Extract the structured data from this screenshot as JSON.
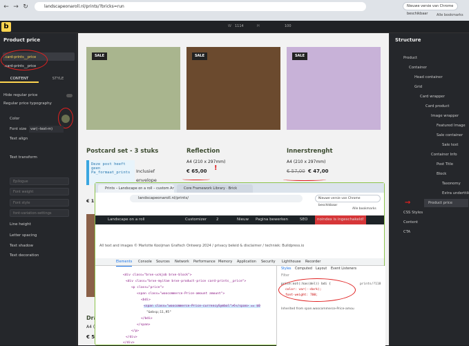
{
  "browser": {
    "url": "landscapeonaroll.nl/prints/?bricks=run",
    "new_version": "Nieuwe versie van Chrome beschikbaar",
    "bookmarks": "Alle bookmarks"
  },
  "toolbar": {
    "logo": "b",
    "width_label": "W",
    "width_value": "1114",
    "height_label": "H",
    "scale_value": "100"
  },
  "left_panel": {
    "title": "Product price",
    "class_active": ".card-prints__price",
    "class_name": ".card-prints__price",
    "tab_content": "CONTENT",
    "tab_style": "STYLE",
    "hide_regular": "Hide regular price",
    "regular_typo": "Regular price typography",
    "color": "Color",
    "font_size": "Font size",
    "font_size_value": "var(--text-m)",
    "text_align": "Text align",
    "text_transform": "Text transform",
    "font_family_ph": "Epilogue",
    "font_weight_ph": "Font weight",
    "font_style_ph": "Font style",
    "font_var_ph": "font-variation-settings",
    "line_height": "Line height",
    "letter_spacing": "Letter spacing",
    "text_shadow": "Text shadow",
    "text_decoration": "Text decoration"
  },
  "products": [
    {
      "title": "Postcard set - 3 stuks",
      "sale": "SALE",
      "sub": "",
      "price": ""
    },
    {
      "title": "Reflection",
      "sale": "SALE",
      "sub": "A4 (210 x 297mm)",
      "price": "€ 65,00"
    },
    {
      "title": "Innerstrenght",
      "sale": "SALE",
      "sub": "A4 (210 x 297mm)",
      "price_old": "€ 57,00",
      "price": "€ 47,00"
    }
  ],
  "canvas_extra": {
    "note": "Deze post heeft geen Pa_formaat_prints",
    "inclusief": "Inclusief",
    "envelope": "envelope",
    "price_partial": "€ 11,",
    "price_partial2": "€ 57",
    "dra": "Dra",
    "a4": "A4 (210"
  },
  "structure": {
    "title": "Structure",
    "items": [
      "Product",
      "Container",
      "Head container",
      "Grid",
      "Card wrapper",
      "Card product",
      "Image wrapper",
      "Featured Image",
      "Sale container",
      "Sale text",
      "Container Info",
      "Post Title",
      "Block",
      "Taxonomy",
      "Extra underttile",
      "Product price",
      "CSS Styles",
      "Content",
      "CTA"
    ]
  },
  "devtools": {
    "tab1": "Prints – Landscape on a roll – custom Artwork",
    "tab2": "Core Framework Library · Brick",
    "url": "landscapeonaroll.nl/prints/",
    "new_version": "Nieuwe versie van Chrome beschikbaar",
    "bookmarks": "Alle bookmarks",
    "wp_items": [
      "Landscape on a roll",
      "Customizer",
      "2",
      "Nieuw",
      "Pagina bewerken",
      "SEO",
      "Bricks",
      "noindex is ingeschakeld!"
    ],
    "footer": "All text and images © Marlotte Kooijman Grafisch Ontwerp 2024 / privacy beleid & disclaimer / techniek: Buildpress.io",
    "tabs": [
      "Elements",
      "Console",
      "Sources",
      "Network",
      "Performance",
      "Memory",
      "Application",
      "Security",
      "Lighthouse",
      "Recorder"
    ],
    "style_tabs": [
      "Styles",
      "Computed",
      "Layout",
      "Event Listeners"
    ],
    "filter": "Filter",
    "code_lines": [
      "<div class=\"brxe-uckjob brxe-block\">",
      "<div class=\"brxe-myitae brxe-product-price card-prints__price\">",
      "<p class=\"price\">",
      "<span class=\"woocommerce-Price-amount amount\">",
      "<bdi>",
      "<span class=\"woocommerce-Price-currencySymbol\">€</span> == $0",
      "\"&nbsp;11,95\"",
      "</bdi>",
      "</span>",
      "</p>",
      "</div>",
      "</div>",
      "</article>"
    ],
    "style_rule": "price:not(:has(del)) bdi {",
    "style_color": "color: var(--dark);",
    "style_weight": "font-weight: 700;",
    "style_file": "prints/?118",
    "inherited": "Inherited from span.woocommerce-Price-amou"
  }
}
